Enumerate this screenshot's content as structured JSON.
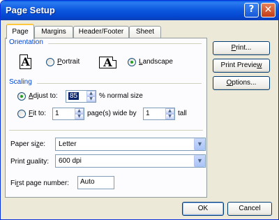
{
  "window": {
    "title": "Page Setup"
  },
  "titlebar": {
    "help_icon": "?",
    "close_icon": "✕"
  },
  "tabs": [
    {
      "label": "Page",
      "active": true
    },
    {
      "label": "Margins",
      "active": false
    },
    {
      "label": "Header/Footer",
      "active": false
    },
    {
      "label": "Sheet",
      "active": false
    }
  ],
  "orientation": {
    "group_label": "Orientation",
    "icon_letter": "A",
    "portrait_label": "Portrait",
    "landscape_label": "Landscape",
    "selected": "landscape"
  },
  "scaling": {
    "group_label": "Scaling",
    "adjust_label": "Adjust to:",
    "adjust_value": "85",
    "adjust_suffix": "% normal size",
    "fit_label": "Fit to:",
    "fit_wide_value": "1",
    "fit_wide_suffix": "page(s) wide by",
    "fit_tall_value": "1",
    "fit_tall_suffix": "tall",
    "selected": "adjust"
  },
  "paper_size": {
    "label": "Paper size:",
    "value": "Letter"
  },
  "print_quality": {
    "label": "Print quality:",
    "value": "600 dpi"
  },
  "first_page_number": {
    "label": "First page number:",
    "value": "Auto"
  },
  "side_buttons": {
    "print": "Print...",
    "print_preview": "Print Preview",
    "options": "Options..."
  },
  "footer": {
    "ok": "OK",
    "cancel": "Cancel"
  },
  "colors": {
    "title_bar": "#0a5fe6",
    "group_label": "#0046d5",
    "dialog_bg": "#ece9d8"
  }
}
